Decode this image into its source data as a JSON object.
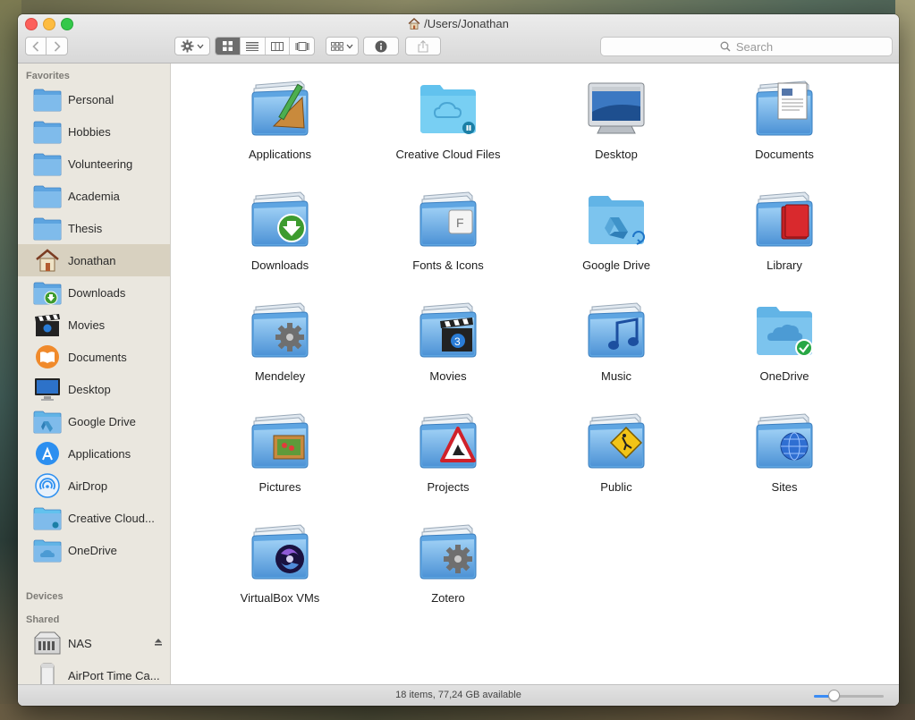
{
  "window": {
    "title": "/Users/Jonathan"
  },
  "toolbar": {
    "back_icon": "chevron-left-icon",
    "forward_icon": "chevron-right-icon",
    "action_icon": "gear-icon",
    "view_modes": [
      "icon",
      "list",
      "column",
      "cover-flow"
    ],
    "active_view": "icon",
    "search_placeholder": "Search"
  },
  "sidebar": {
    "favorites_heading": "Favorites",
    "favorites": [
      {
        "label": "Personal",
        "icon": "folder-icon"
      },
      {
        "label": "Hobbies",
        "icon": "folder-icon"
      },
      {
        "label": "Volunteering",
        "icon": "folder-icon"
      },
      {
        "label": "Academia",
        "icon": "folder-icon"
      },
      {
        "label": "Thesis",
        "icon": "folder-icon"
      },
      {
        "label": "Jonathan",
        "icon": "home-icon",
        "selected": true
      },
      {
        "label": "Downloads",
        "icon": "downloads-folder-icon"
      },
      {
        "label": "Movies",
        "icon": "clapperboard-icon"
      },
      {
        "label": "Documents",
        "icon": "ibooks-icon"
      },
      {
        "label": "Desktop",
        "icon": "monitor-icon"
      },
      {
        "label": "Google Drive",
        "icon": "google-drive-folder-icon"
      },
      {
        "label": "Applications",
        "icon": "app-store-icon"
      },
      {
        "label": "AirDrop",
        "icon": "airdrop-icon"
      },
      {
        "label": "Creative Cloud...",
        "icon": "creative-cloud-folder-icon"
      },
      {
        "label": "OneDrive",
        "icon": "onedrive-folder-icon"
      }
    ],
    "devices_heading": "Devices",
    "shared_heading": "Shared",
    "shared": [
      {
        "label": "NAS",
        "icon": "nas-icon"
      },
      {
        "label": "AirPort Time Ca...",
        "icon": "airport-time-capsule-icon"
      }
    ]
  },
  "files": [
    {
      "label": "Applications",
      "icon": "applications-folder-icon"
    },
    {
      "label": "Creative Cloud Files",
      "icon": "creative-cloud-folder-icon"
    },
    {
      "label": "Desktop",
      "icon": "desktop-screen-icon"
    },
    {
      "label": "Documents",
      "icon": "documents-folder-icon"
    },
    {
      "label": "Downloads",
      "icon": "downloads-folder-icon"
    },
    {
      "label": "Fonts & Icons",
      "icon": "fonts-folder-icon"
    },
    {
      "label": "Google Drive",
      "icon": "google-drive-folder-icon"
    },
    {
      "label": "Library",
      "icon": "library-folder-icon"
    },
    {
      "label": "Mendeley",
      "icon": "gear-folder-icon"
    },
    {
      "label": "Movies",
      "icon": "movies-folder-icon"
    },
    {
      "label": "Music",
      "icon": "music-folder-icon"
    },
    {
      "label": "OneDrive",
      "icon": "onedrive-folder-icon"
    },
    {
      "label": "Pictures",
      "icon": "pictures-folder-icon"
    },
    {
      "label": "Projects",
      "icon": "roadwork-folder-icon"
    },
    {
      "label": "Public",
      "icon": "public-folder-icon"
    },
    {
      "label": "Sites",
      "icon": "sites-folder-icon"
    },
    {
      "label": "VirtualBox VMs",
      "icon": "virtualbox-folder-icon"
    },
    {
      "label": "Zotero",
      "icon": "gear-folder-icon"
    }
  ],
  "status": {
    "text": "18 items, 77,24 GB available",
    "zoom_level": 0.28
  },
  "colors": {
    "folder_blue": "#6fb1e8",
    "selected_sidebar": "#d8d1c0",
    "sidebar_bg": "#eae7df",
    "accent": "#3b8cf5"
  }
}
